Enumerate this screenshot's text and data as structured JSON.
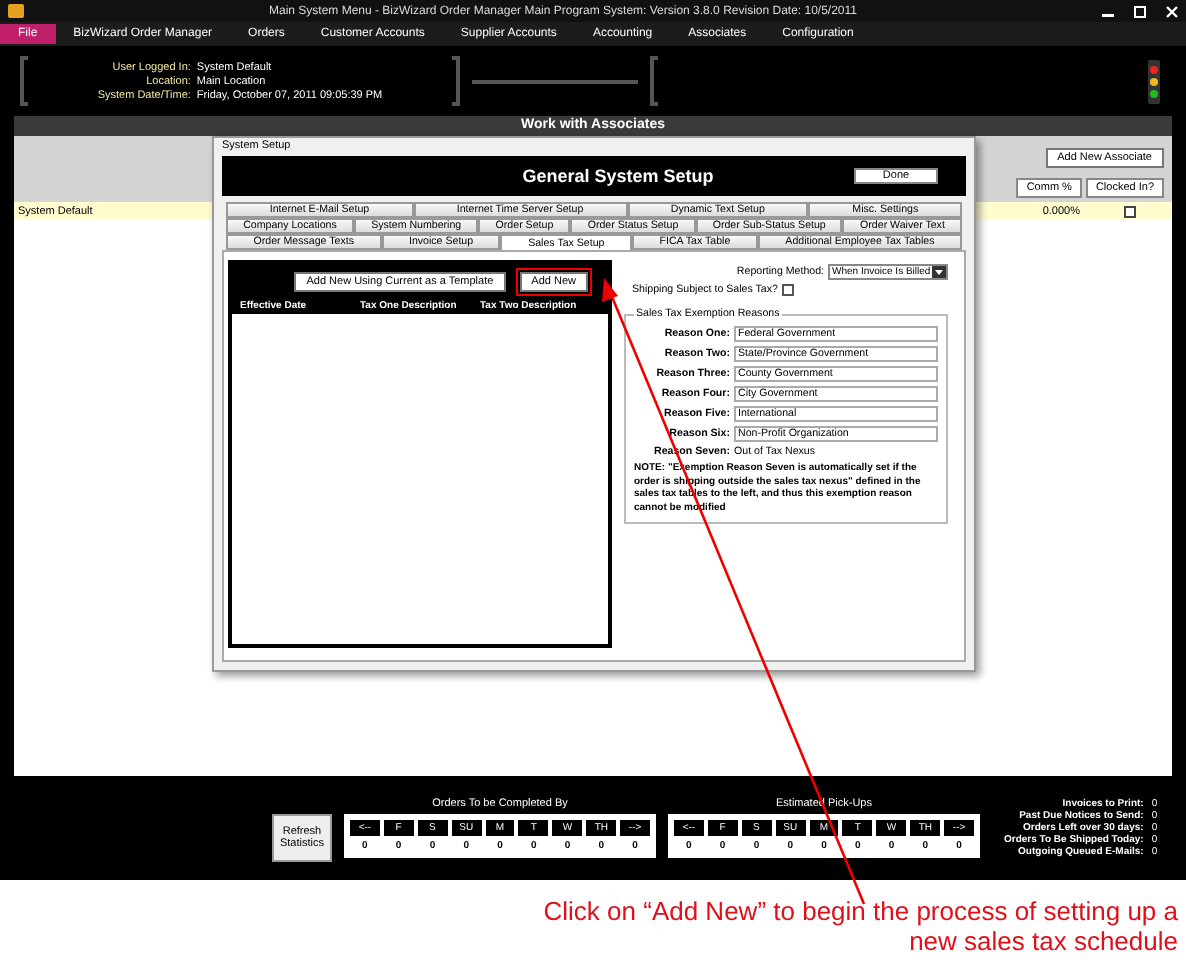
{
  "window": {
    "title": "Main System Menu - BizWizard Order Manager Main Program System: Version 3.8.0  Revision Date: 10/5/2011"
  },
  "menu": [
    {
      "label": "File",
      "selected": true
    },
    {
      "label": "BizWizard Order Manager",
      "selected": false
    },
    {
      "label": "Orders",
      "selected": false
    },
    {
      "label": "Customer Accounts",
      "selected": false
    },
    {
      "label": "Supplier Accounts",
      "selected": false
    },
    {
      "label": "Accounting",
      "selected": false
    },
    {
      "label": "Associates",
      "selected": false
    },
    {
      "label": "Configuration",
      "selected": false
    }
  ],
  "header": {
    "fields": [
      {
        "label": "User Logged In:",
        "value": "System Default"
      },
      {
        "label": "Location:",
        "value": "Main Location"
      },
      {
        "label": "System Date/Time:",
        "value": "Friday, October 07, 2011    09:05:39 PM"
      }
    ]
  },
  "associates": {
    "title": "Work with Associates",
    "add_button": "Add New Associate",
    "columns": [
      "Comm %",
      "Clocked In?"
    ],
    "rows": [
      {
        "name": "System Default",
        "comm": "0.000%",
        "clocked_in": false
      }
    ]
  },
  "dialog": {
    "title": "System Setup",
    "heading": "General System Setup",
    "done": "Done",
    "tab_rows": [
      [
        {
          "label": "Internet E-Mail Setup",
          "selected": false
        },
        {
          "label": "Internet Time Server Setup",
          "selected": false
        },
        {
          "label": "Dynamic Text Setup",
          "selected": false
        },
        {
          "label": "Misc. Settings",
          "selected": false
        }
      ],
      [
        {
          "label": "Company Locations",
          "selected": false
        },
        {
          "label": "System Numbering",
          "selected": false
        },
        {
          "label": "Order Setup",
          "selected": false
        },
        {
          "label": "Order Status Setup",
          "selected": false
        },
        {
          "label": "Order Sub-Status Setup",
          "selected": false
        },
        {
          "label": "Order Waiver Text",
          "selected": false
        }
      ],
      [
        {
          "label": "Order Message Texts",
          "selected": false
        },
        {
          "label": "Invoice Setup",
          "selected": false
        },
        {
          "label": "Sales Tax Setup",
          "selected": true
        },
        {
          "label": "FICA Tax Table",
          "selected": false
        },
        {
          "label": "Additional Employee Tax Tables",
          "selected": false
        }
      ]
    ],
    "list": {
      "buttons": [
        {
          "label": "Add New Using Current as a Template",
          "highlighted": false
        },
        {
          "label": "Add New",
          "highlighted": true
        }
      ],
      "columns": [
        "Effective Date",
        "Tax One Description",
        "Tax Two Description"
      ]
    },
    "reporting_method": {
      "label": "Reporting Method:",
      "value": "When Invoice Is Billed"
    },
    "shipping": {
      "label": "Shipping Subject to Sales Tax?",
      "checked": false
    },
    "exemptions": {
      "title": "Sales Tax Exemption Reasons",
      "reasons": [
        {
          "kind": "field",
          "label": "Reason One:",
          "value": "Federal Government"
        },
        {
          "kind": "field",
          "label": "Reason Two:",
          "value": "State/Province Government"
        },
        {
          "kind": "field",
          "label": "Reason Three:",
          "value": "County Government"
        },
        {
          "kind": "field",
          "label": "Reason Four:",
          "value": "City Government"
        },
        {
          "kind": "field",
          "label": "Reason Five:",
          "value": "International"
        },
        {
          "kind": "field",
          "label": "Reason Six:",
          "value": "Non-Profit Organization"
        },
        {
          "kind": "text",
          "label": "Reason Seven:",
          "value": "Out of Tax Nexus"
        }
      ],
      "note": "NOTE: \"Exemption Reason Seven is automatically set if the order is shipping outside the sales tax nexus\" defined in the sales tax tables to the left, and thus this exemption reason cannot be modified"
    }
  },
  "footer": {
    "refresh": "Refresh Statistics",
    "groups": [
      {
        "title": "Orders To be Completed By",
        "days": [
          "<--",
          "F",
          "S",
          "SU",
          "M",
          "T",
          "W",
          "TH",
          "-->"
        ],
        "counts": [
          "0",
          "0",
          "0",
          "0",
          "0",
          "0",
          "0",
          "0",
          "0"
        ]
      },
      {
        "title": "Estimated Pick-Ups",
        "days": [
          "<--",
          "F",
          "S",
          "SU",
          "M",
          "T",
          "W",
          "TH",
          "-->"
        ],
        "counts": [
          "0",
          "0",
          "0",
          "0",
          "0",
          "0",
          "0",
          "0",
          "0"
        ]
      }
    ],
    "stats": [
      {
        "label": "Invoices to Print:",
        "value": "0"
      },
      {
        "label": "Past Due Notices to Send:",
        "value": "0"
      },
      {
        "label": "Orders Left over 30 days:",
        "value": "0"
      },
      {
        "label": "Orders To Be Shipped Today:",
        "value": "0"
      },
      {
        "label": "Outgoing Queued E-Mails:",
        "value": "0"
      }
    ]
  },
  "annotation": "Click on “Add New” to begin the process of setting up a new sales tax schedule"
}
